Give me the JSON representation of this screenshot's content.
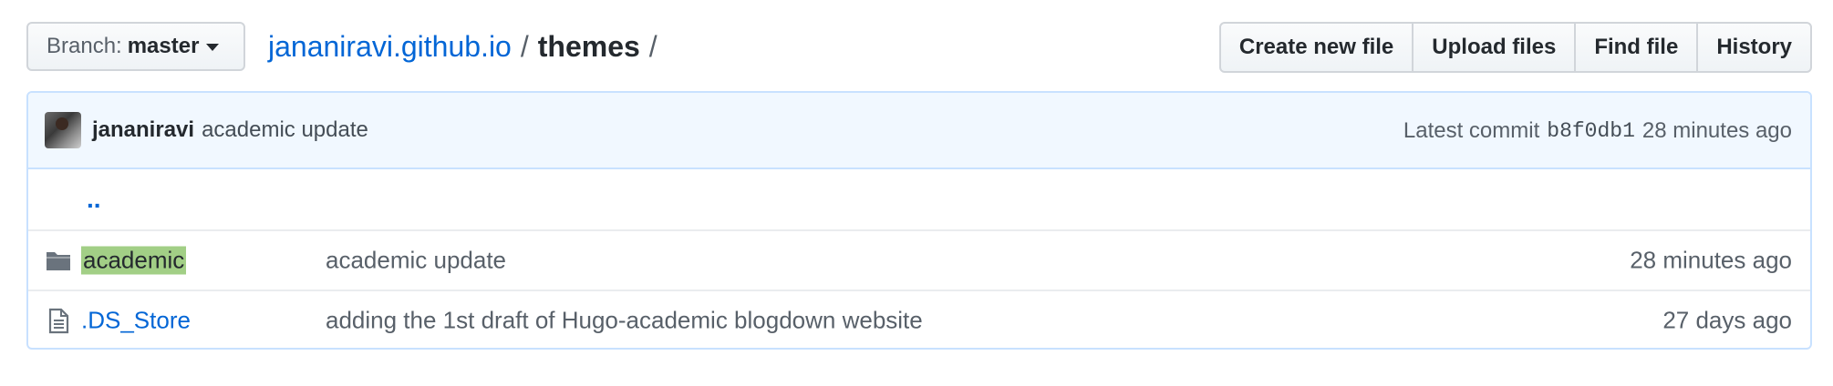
{
  "branch": {
    "label": "Branch:",
    "value": "master"
  },
  "breadcrumb": {
    "repo": "jananiravi.github.io",
    "separator": "/",
    "directory": "themes",
    "trailing_separator": "/"
  },
  "actions": {
    "create_new_file": "Create new file",
    "upload_files": "Upload files",
    "find_file": "Find file",
    "history": "History"
  },
  "latest_commit": {
    "author": "jananiravi",
    "message": "academic update",
    "prefix": "Latest commit",
    "sha": "b8f0db1",
    "age": "28 minutes ago"
  },
  "parent_dir": "..",
  "files": [
    {
      "type": "directory",
      "icon": "folder-icon",
      "name": "academic",
      "highlighted": true,
      "commit_message": "academic update",
      "age": "28 minutes ago"
    },
    {
      "type": "file",
      "icon": "file-icon",
      "name": ".DS_Store",
      "highlighted": false,
      "commit_message": "adding the 1st draft of Hugo-academic blogdown website",
      "age": "27 days ago"
    }
  ],
  "colors": {
    "link": "#0366d6",
    "header_bg": "#f1f8ff",
    "header_border": "#c8e1ff",
    "highlight": "#a2cf86",
    "icon": "#6a737d"
  }
}
